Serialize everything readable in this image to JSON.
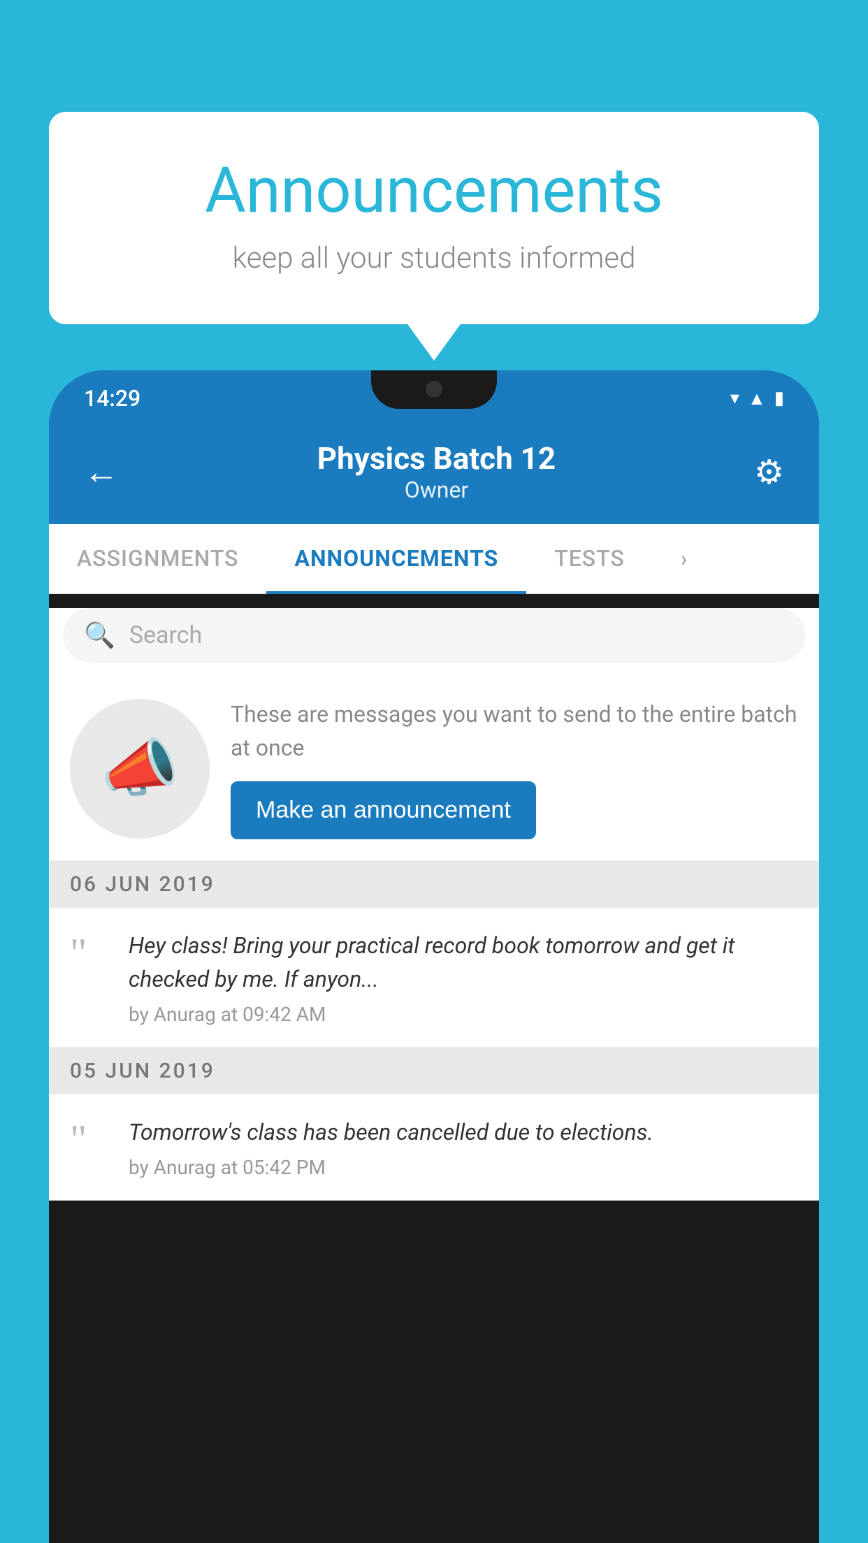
{
  "background_color": "#29b6d8",
  "speech_bubble": {
    "title": "Announcements",
    "subtitle": "keep all your students informed"
  },
  "phone": {
    "status_bar": {
      "time": "14:29",
      "icons": [
        "wifi",
        "signal",
        "battery"
      ]
    },
    "header": {
      "title": "Physics Batch 12",
      "subtitle": "Owner",
      "back_label": "←",
      "gear_label": "⚙"
    },
    "tabs": [
      {
        "label": "ASSIGNMENTS",
        "active": false
      },
      {
        "label": "ANNOUNCEMENTS",
        "active": true
      },
      {
        "label": "TESTS",
        "active": false
      },
      {
        "label": "...",
        "active": false
      }
    ],
    "search": {
      "placeholder": "Search"
    },
    "promo": {
      "description": "These are messages you want to send to the entire batch at once",
      "button_label": "Make an announcement"
    },
    "announcements": [
      {
        "date": "06  JUN  2019",
        "text": "Hey class! Bring your practical record book tomorrow and get it checked by me. If anyon...",
        "meta": "by Anurag at 09:42 AM"
      },
      {
        "date": "05  JUN  2019",
        "text": "Tomorrow's class has been cancelled due to elections.",
        "meta": "by Anurag at 05:42 PM"
      }
    ]
  }
}
